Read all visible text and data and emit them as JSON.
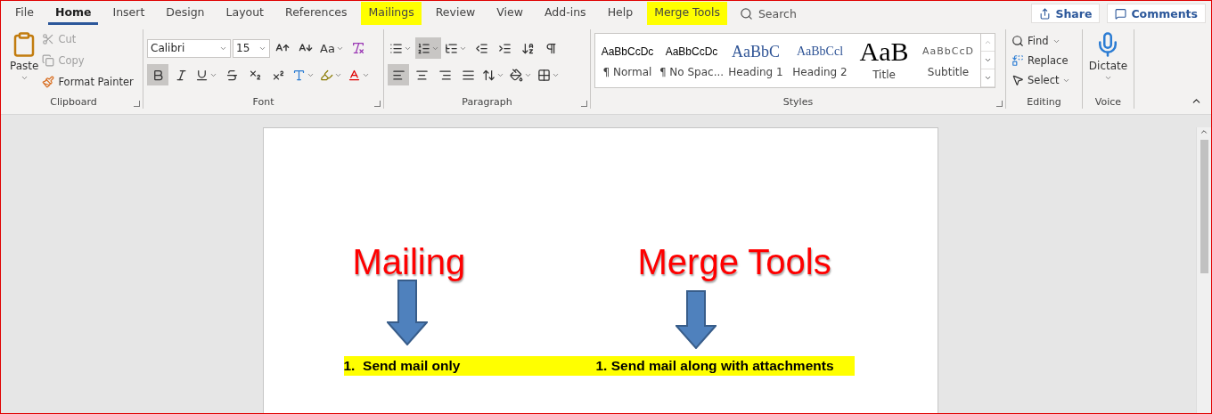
{
  "tabs": [
    {
      "label": "File",
      "selected": false,
      "highlighted": false
    },
    {
      "label": "Home",
      "selected": true,
      "highlighted": false
    },
    {
      "label": "Insert",
      "selected": false,
      "highlighted": false
    },
    {
      "label": "Design",
      "selected": false,
      "highlighted": false
    },
    {
      "label": "Layout",
      "selected": false,
      "highlighted": false
    },
    {
      "label": "References",
      "selected": false,
      "highlighted": false
    },
    {
      "label": "Mailings",
      "selected": false,
      "highlighted": true
    },
    {
      "label": "Review",
      "selected": false,
      "highlighted": false
    },
    {
      "label": "View",
      "selected": false,
      "highlighted": false
    },
    {
      "label": "Add-ins",
      "selected": false,
      "highlighted": false
    },
    {
      "label": "Help",
      "selected": false,
      "highlighted": false
    },
    {
      "label": "Merge Tools",
      "selected": false,
      "highlighted": true
    }
  ],
  "search": {
    "placeholder": "Search"
  },
  "share_button": "Share",
  "comments_button": "Comments",
  "clipboard": {
    "label": "Clipboard",
    "paste": "Paste",
    "cut": {
      "label": "Cut",
      "disabled": true
    },
    "copy": {
      "label": "Copy",
      "disabled": true
    },
    "format_painter": {
      "label": "Format Painter",
      "disabled": false
    }
  },
  "font": {
    "label": "Font",
    "font_name": "Calibri",
    "font_size": "15",
    "change_case": "Aa",
    "format_buttons": [
      {
        "kind": "bold",
        "selected": true
      },
      {
        "kind": "italic",
        "selected": false
      },
      {
        "kind": "underline",
        "selected": false
      },
      {
        "kind": "strike",
        "selected": false
      },
      {
        "kind": "subscript",
        "selected": false
      },
      {
        "kind": "superscript",
        "selected": false
      },
      {
        "kind": "effects",
        "selected": false
      },
      {
        "kind": "highlight",
        "selected": false
      },
      {
        "kind": "color",
        "selected": false
      }
    ]
  },
  "paragraph": {
    "label": "Paragraph",
    "row_1": [
      {
        "kind": "bullets",
        "selected": false
      },
      {
        "kind": "numbering",
        "selected": true
      },
      {
        "kind": "multilevel",
        "selected": false
      },
      {
        "kind": "outdent",
        "selected": false
      },
      {
        "kind": "indent",
        "selected": false
      },
      {
        "kind": "sort",
        "selected": false
      },
      {
        "kind": "marks",
        "selected": false
      }
    ],
    "row_2": [
      {
        "kind": "left",
        "selected": true
      },
      {
        "kind": "center",
        "selected": false
      },
      {
        "kind": "right",
        "selected": false
      },
      {
        "kind": "justify",
        "selected": false
      },
      {
        "kind": "spacing",
        "selected": false
      },
      {
        "kind": "shading",
        "selected": false
      },
      {
        "kind": "borders",
        "selected": false
      }
    ]
  },
  "styles": {
    "label": "Styles",
    "items": [
      {
        "sample": "AaBbCcDc",
        "name": "¶ Normal",
        "kind": "normal"
      },
      {
        "sample": "AaBbCcDc",
        "name": "¶ No Spac...",
        "kind": "normal"
      },
      {
        "sample": "AaBbC",
        "name": "Heading 1",
        "kind": "heading1"
      },
      {
        "sample": "AaBbCcl",
        "name": "Heading 2",
        "kind": "heading2"
      },
      {
        "sample": "AaB",
        "name": "Title",
        "kind": "title"
      },
      {
        "sample": "AaBbCcD",
        "name": "Subtitle",
        "kind": "subtitle"
      }
    ]
  },
  "editing": {
    "label": "Editing",
    "find": "Find",
    "replace": "Replace",
    "select": "Select"
  },
  "voice": {
    "label": "Voice",
    "dictate": "Dictate"
  },
  "document": {
    "callouts": [
      "Mailing",
      "Merge Tools"
    ],
    "list_items": [
      "1.  Send mail only",
      "1. Send mail along with attachments"
    ]
  }
}
